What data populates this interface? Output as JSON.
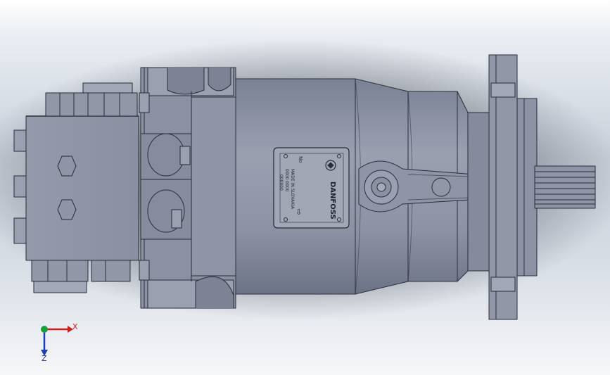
{
  "viewport": {
    "background_top": "#ffffff",
    "background_mid": "#c9d0da",
    "background_bottom": "#f6f7f9"
  },
  "model": {
    "body_color": "#8e94a6",
    "shade_color": "#737a8d",
    "light_color": "#a9aebd",
    "edge_color": "#2a2d38",
    "nameplate": {
      "brand": "DANFOSS",
      "label_no": "No",
      "lines": [
        "MADE IN SLOVAKIA",
        "0000 0000",
        "000000"
      ],
      "arrow": "⇩"
    }
  },
  "triad": {
    "x_label": "X",
    "z_label": "Z",
    "x_color": "#d11b1b",
    "y_color": "#15a03a",
    "z_color": "#1c3fb8"
  }
}
